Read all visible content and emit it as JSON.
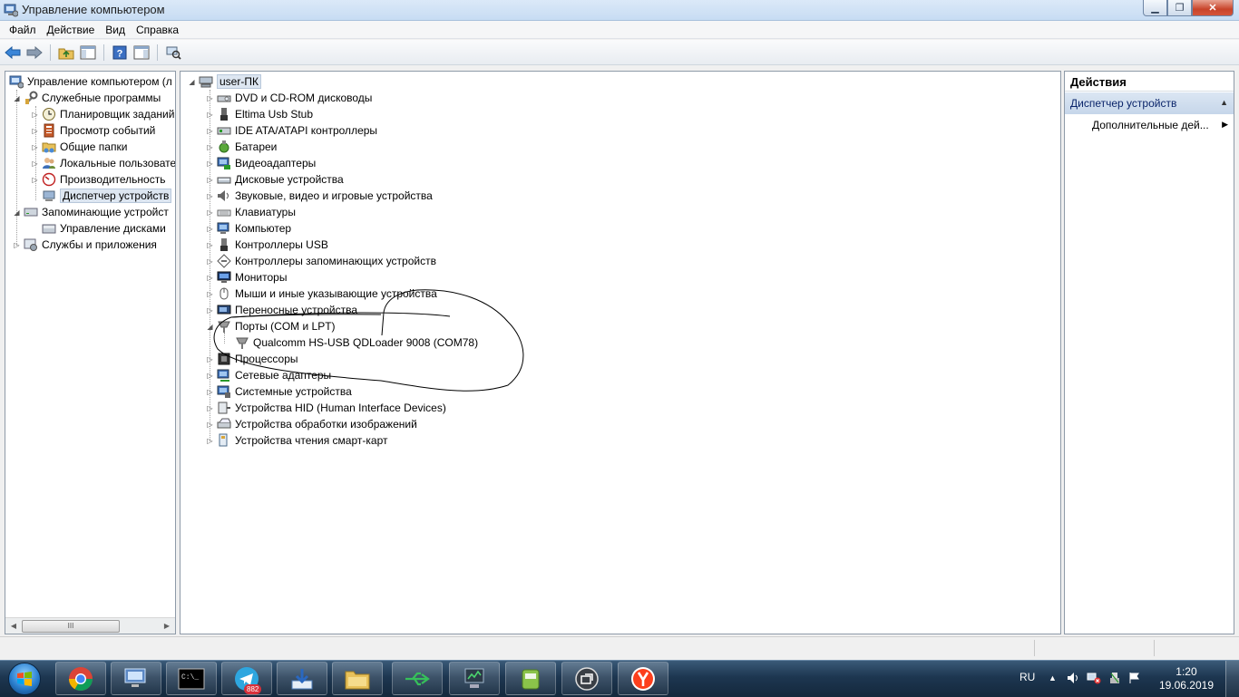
{
  "window": {
    "title": "Управление компьютером",
    "min_label": "▁",
    "max_label": "❐",
    "close_label": "✕"
  },
  "menu": [
    "Файл",
    "Действие",
    "Вид",
    "Справка"
  ],
  "toolbar": {
    "icons": [
      "back-icon",
      "forward-icon",
      "up-folder-icon",
      "show-hide-console-tree-icon",
      "help-icon",
      "show-hide-action-pane-icon",
      "scan-hardware-icon"
    ]
  },
  "left_tree": {
    "root": "Управление компьютером (л",
    "utilities": "Служебные программы",
    "scheduler": "Планировщик заданий",
    "event_viewer": "Просмотр событий",
    "shared_folders": "Общие папки",
    "local_users": "Локальные пользовате",
    "performance": "Производительность",
    "device_manager": "Диспетчер устройств",
    "storage": "Запоминающие устройст",
    "disk_management": "Управление дисками",
    "services_apps": "Службы и приложения",
    "scroll_thumb": "III"
  },
  "device_tree": {
    "computer_name": "user-ПК",
    "categories": [
      {
        "label": "DVD и CD-ROM дисководы",
        "icon": "dvd-drive-icon"
      },
      {
        "label": "Eltima Usb Stub",
        "icon": "usb-stub-icon"
      },
      {
        "label": "IDE ATA/ATAPI контроллеры",
        "icon": "ide-controller-icon"
      },
      {
        "label": "Батареи",
        "icon": "battery-icon"
      },
      {
        "label": "Видеоадаптеры",
        "icon": "display-adapter-icon"
      },
      {
        "label": "Дисковые устройства",
        "icon": "disk-drive-icon"
      },
      {
        "label": "Звуковые, видео и игровые устройства",
        "icon": "sound-icon"
      },
      {
        "label": "Клавиатуры",
        "icon": "keyboard-icon"
      },
      {
        "label": "Компьютер",
        "icon": "computer-icon"
      },
      {
        "label": "Контроллеры USB",
        "icon": "usb-controller-icon"
      },
      {
        "label": "Контроллеры запоминающих устройств",
        "icon": "storage-controller-icon"
      },
      {
        "label": "Мониторы",
        "icon": "monitor-icon"
      },
      {
        "label": "Мыши и иные указывающие устройства",
        "icon": "mouse-icon"
      },
      {
        "label": "Переносные устройства",
        "icon": "portable-device-icon"
      },
      {
        "label": "Порты (COM и LPT)",
        "icon": "port-icon",
        "expanded": true
      },
      {
        "label": "Qualcomm HS-USB QDLoader 9008 (COM78)",
        "icon": "port-device-icon",
        "child": true
      },
      {
        "label": "Процессоры",
        "icon": "processor-icon"
      },
      {
        "label": "Сетевые адаптеры",
        "icon": "network-adapter-icon"
      },
      {
        "label": "Системные устройства",
        "icon": "system-device-icon"
      },
      {
        "label": "Устройства HID (Human Interface Devices)",
        "icon": "hid-icon"
      },
      {
        "label": "Устройства обработки изображений",
        "icon": "imaging-device-icon"
      },
      {
        "label": "Устройства чтения смарт-карт",
        "icon": "smart-card-reader-icon"
      }
    ]
  },
  "actions": {
    "header": "Действия",
    "section": "Диспетчер устройств",
    "more": "Дополнительные дей..."
  },
  "taskbar": {
    "apps": [
      "chrome-icon",
      "computer-management-icon",
      "cmd-icon",
      "telegram-icon",
      "download-icon",
      "explorer-icon",
      "usb-tool-icon",
      "device-tool-icon",
      "android-icon",
      "remote-icon",
      "yandex-browser-icon"
    ],
    "telegram_badge": "882",
    "lang": "RU",
    "time": "1:20",
    "date": "19.06.2019"
  },
  "colors": {
    "selection": "#dde6f1",
    "annotation_stroke": "#000000",
    "taskbar": "#1d3650"
  }
}
